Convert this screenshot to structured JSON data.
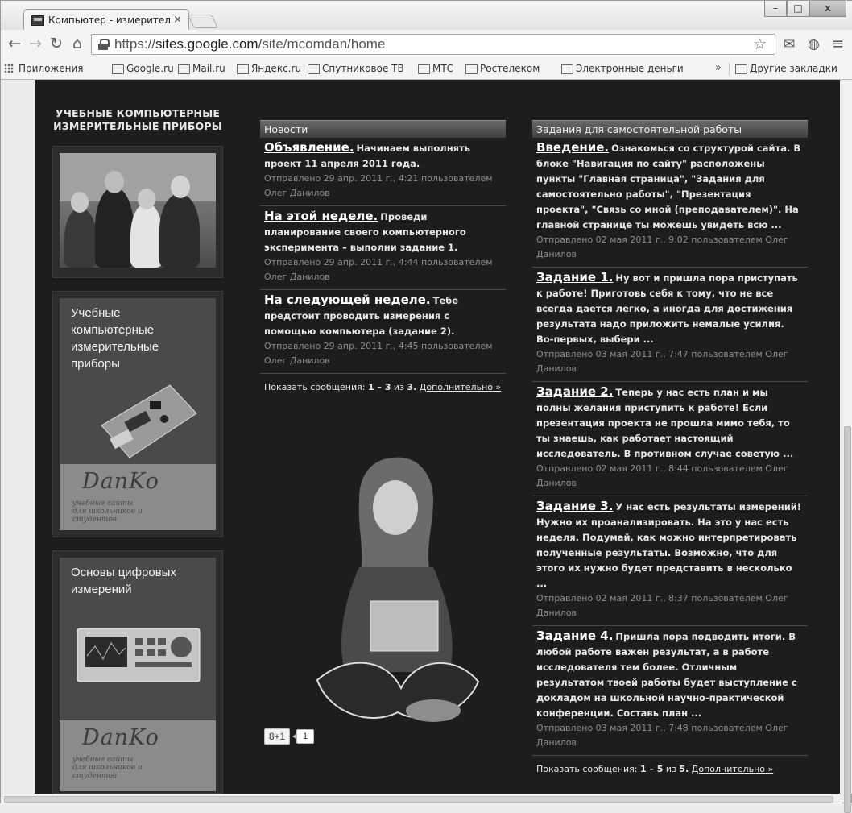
{
  "browser": {
    "tab_title": "Компьютер - измерител",
    "tab_close": "×",
    "window_controls": {
      "minimize": "–",
      "maximize": "□",
      "close": "x"
    },
    "url_prefix": "https://",
    "url_host": "sites.google.com",
    "url_path": "/site/mcomdan/home",
    "bookmarks": [
      "Приложения",
      "Google.ru",
      "Mail.ru",
      "Яндекс.ru",
      "Спутниковое ТВ",
      "МТС",
      "Ростелеком",
      "Электронные деньги"
    ],
    "bookmarks_more": "»",
    "other_bookmarks": "Другие закладки"
  },
  "site": {
    "title_line1": "УЧЕБНЫЕ КОМПЬЮТЕРНЫЕ",
    "title_line2": "ИЗМЕРИТЕЛЬНЫЕ ПРИБОРЫ",
    "banners": [
      {
        "title": "Учебные компьютерные измерительные приборы",
        "logo": "DanKo",
        "sub": "учебные сайты для школьников и студентов"
      },
      {
        "title": "Основы цифровых измерений",
        "logo": "DanKo",
        "sub": "учебные сайты для школьников и студентов"
      }
    ]
  },
  "news": {
    "header": "Новости",
    "posts": [
      {
        "title": "Объявление.",
        "text": "Начинаем выполнять проект 11 апреля 2011 года.",
        "meta": "Отправлено 29 апр. 2011 г., 4:21 пользователем Олег Данилов"
      },
      {
        "title": "На этой неделе.",
        "text": "Проведи планирование своего компьютерного эксперимента – выполни задание 1.",
        "meta": "Отправлено 29 апр. 2011 г., 4:44 пользователем Олег Данилов"
      },
      {
        "title": "На следующей неделе.",
        "text": "Тебе предстоит проводить измерения с помощью компьютера (задание 2).",
        "meta": "Отправлено 29 апр. 2011 г., 4:45 пользователем Олег Данилов"
      }
    ],
    "show_label": "Показать сообщения:",
    "show_count": "1 – 3",
    "show_of": "из",
    "show_total": "3.",
    "show_more": "Дополнительно »"
  },
  "tasks": {
    "header": "Задания для самостоятельной работы",
    "posts": [
      {
        "title": "Введение.",
        "text": "Ознакомься со структурой сайта. В блоке \"Навигация по сайту\" расположены пункты \"Главная страница\", \"Задания для самостоятельно работы\", \"Презентация проекта\", \"Связь со мной (преподавателем)\". На главной странице ты можешь увидеть всю ...",
        "meta": "Отправлено 02 мая 2011 г., 9:02 пользователем Олег Данилов"
      },
      {
        "title": "Задание 1.",
        "text": "Ну вот и пришла пора приступать к работе! Приготовь себя к тому, что не все всегда дается легко, а иногда для достижения результата надо приложить немалые усилия. Во-первых, выбери ...",
        "meta": "Отправлено 03 мая 2011 г., 7:47 пользователем Олег Данилов"
      },
      {
        "title": "Задание 2.",
        "text": "Теперь у нас есть план и мы полны желания приступить к работе! Если презентация проекта не прошла мимо тебя, то ты знаешь, как работает настоящий исследователь. В противном случае советую ...",
        "meta": "Отправлено 02 мая 2011 г., 8:44 пользователем Олег Данилов"
      },
      {
        "title": "Задание 3.",
        "text": "У нас есть результаты измерений! Нужно их проанализировать. На это у нас есть неделя. Подумай, как можно интерпретировать полученные результаты. Возможно, что для этого их нужно будет представить в несколько ...",
        "meta": "Отправлено 02 мая 2011 г., 8:37 пользователем Олег Данилов"
      },
      {
        "title": "Задание 4.",
        "text": "Пришла пора подводить итоги. В любой работе важен результат, а в работе исследователя тем более. Отличным результатом твоей работы будет выступление с докладом на школьной научно-практической конференции. Составь план ...",
        "meta": "Отправлено 03 мая 2011 г., 7:48 пользователем Олег Данилов"
      }
    ],
    "show_label": "Показать сообщения:",
    "show_count": "1 – 5",
    "show_of": "из",
    "show_total": "5.",
    "show_more": "Дополнительно »"
  },
  "gplus": {
    "label": "8+1",
    "count": "1"
  }
}
